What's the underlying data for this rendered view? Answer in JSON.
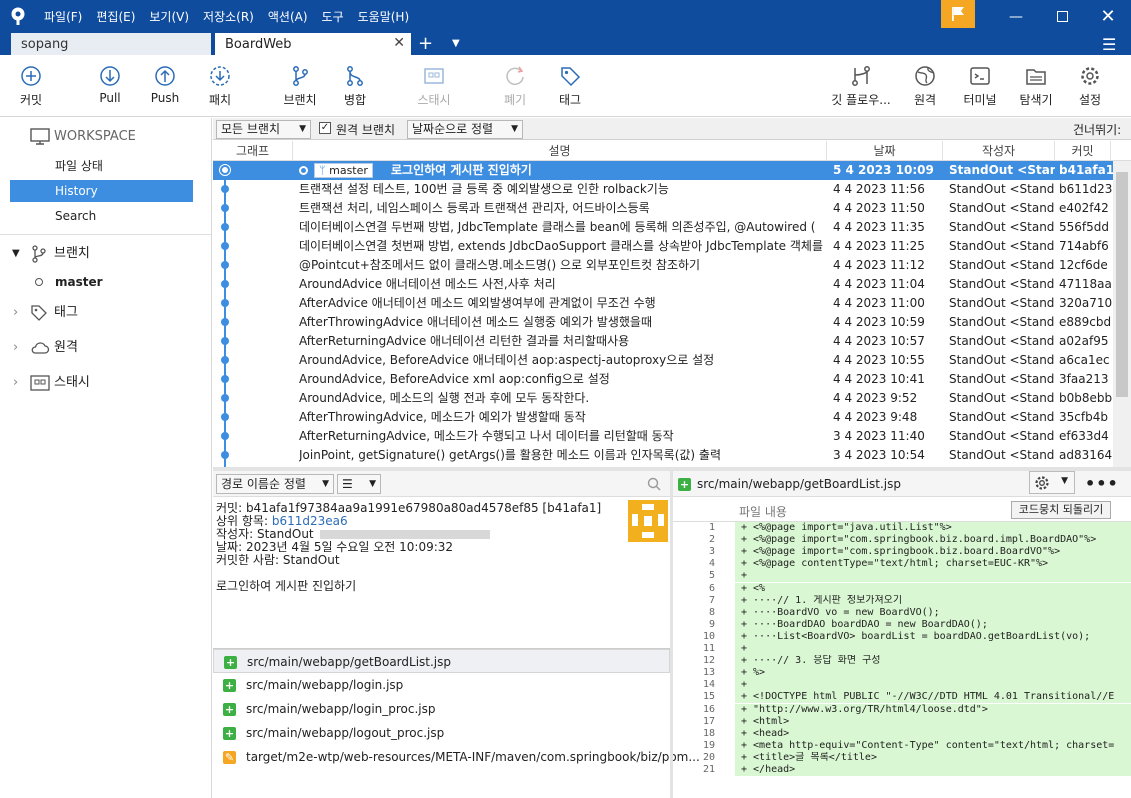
{
  "menu": [
    "파일(F)",
    "편집(E)",
    "보기(V)",
    "저장소(R)",
    "액션(A)",
    "도구",
    "도움말(H)"
  ],
  "tabs": {
    "inactive": "sopang",
    "active": "BoardWeb"
  },
  "toolbar": {
    "commit": "커밋",
    "pull": "Pull",
    "push": "Push",
    "fetch": "패치",
    "branch": "브랜치",
    "merge": "병합",
    "stash": "스태시",
    "discard": "폐기",
    "tag": "태그",
    "gitflow": "깃 플로우...",
    "remote": "원격",
    "terminal": "터미널",
    "explorer": "탐색기",
    "settings": "설정"
  },
  "sidebar": {
    "workspace": "WORKSPACE",
    "file_status": "파일 상태",
    "history": "History",
    "search": "Search",
    "branches": "브랜치",
    "branch_master": "master",
    "tags": "태그",
    "remotes": "원격",
    "stashes": "스태시"
  },
  "filter": {
    "branches": "모든 브랜치",
    "remote_branches": "원격 브랜치",
    "sort": "날짜순으로 정렬",
    "jump": "건너뛰기:"
  },
  "columns": {
    "graph": "그래프",
    "desc": "설명",
    "date": "날짜",
    "author": "작성자",
    "commit": "커밋"
  },
  "commits": [
    {
      "desc": "로그인하여 게시판 진입하기",
      "date": "5 4 2023 10:09",
      "author": "StandOut <Stand",
      "hash": "b41afa1",
      "branch": "master"
    },
    {
      "desc": "트랜잭션 설정 테스트, 100번 글 등록 중 예외발생으로 인한 rolback기능",
      "date": "4 4 2023 11:56",
      "author": "StandOut <Stand(",
      "hash": "b611d23"
    },
    {
      "desc": "트랜잭션 처리, 네임스페이스 등록과 트랜잭션 관리자, 어드바이스등록",
      "date": "4 4 2023 11:50",
      "author": "StandOut <Stand(",
      "hash": "e402f42"
    },
    {
      "desc": "데이터베이스연결 두번째 방법, JdbcTemplate 클래스를 bean에 등록해 의존성주입, @Autowired (",
      "date": "4 4 2023 11:35",
      "author": "StandOut <Stand(",
      "hash": "556f5dd"
    },
    {
      "desc": "데이터베이스연결 첫번째 방법, extends JdbcDaoSupport 클래스를 상속받아 JdbcTemplate 객체를",
      "date": "4 4 2023 11:25",
      "author": "StandOut <Stand(",
      "hash": "714abf6"
    },
    {
      "desc": "@Pointcut+참조메서드 없이 클래스명.메소드명() 으로 외부포인트컷 참조하기",
      "date": "4 4 2023 11:12",
      "author": "StandOut <Stand(",
      "hash": "12cf6de"
    },
    {
      "desc": "AroundAdvice 애너테이션 메소드 사전,사후 처리",
      "date": "4 4 2023 11:04",
      "author": "StandOut <Stand(",
      "hash": "47118aa"
    },
    {
      "desc": "AfterAdvice 애너테이션 메소드 예외발생여부에 관계없이 무조건 수행",
      "date": "4 4 2023 11:00",
      "author": "StandOut <Stand(",
      "hash": "320a710"
    },
    {
      "desc": "AfterThrowingAdvice 애너테이션 메소드 실행중 예외가 발생했을때",
      "date": "4 4 2023 10:59",
      "author": "StandOut <Stand(",
      "hash": "e889cbd"
    },
    {
      "desc": "AfterReturningAdvice 애너테이션 리턴한 결과를 처리할때사용",
      "date": "4 4 2023 10:57",
      "author": "StandOut <Stand(",
      "hash": "a02af95"
    },
    {
      "desc": "AroundAdvice, BeforeAdvice 애너테이션 aop:aspectj-autoproxy으로 설정",
      "date": "4 4 2023 10:55",
      "author": "StandOut <Stand(",
      "hash": "a6ca1ec"
    },
    {
      "desc": "AroundAdvice, BeforeAdvice xml aop:config으로 설정",
      "date": "4 4 2023 10:41",
      "author": "StandOut <Stand(",
      "hash": "3faa213"
    },
    {
      "desc": "AroundAdvice, 메소드의 실행 전과 후에 모두 동작한다.",
      "date": "4 4 2023 9:52",
      "author": "StandOut <Stand(",
      "hash": "b0b8ebb"
    },
    {
      "desc": "AfterThrowingAdvice, 메소드가 예외가 발생할때 동작",
      "date": "4 4 2023 9:48",
      "author": "StandOut <Stand(",
      "hash": "35cfb4b"
    },
    {
      "desc": "AfterReturningAdvice, 메소드가 수행되고 나서 데이터를 리턴할때 동작",
      "date": "3 4 2023 11:40",
      "author": "StandOut <Stand(",
      "hash": "ef633d4"
    },
    {
      "desc": "JoinPoint, getSignature() getArgs()를 활용한 메소드 이름과 인자목록(값) 출력",
      "date": "3 4 2023 10:54",
      "author": "StandOut <Stand(",
      "hash": "ad83164"
    }
  ],
  "lower": {
    "sort": "경로 이름순 정렬",
    "commit_line": "커밋: b41afa1f97384aa9a1991e67980a80ad4578ef85 [b41afa1]",
    "parent_label": "상위 항목:",
    "parent_hash": "b611d23ea6",
    "author_line": "작성자: StandOut",
    "date_line": "날짜: 2023년 4월 5일 수요일 오전 10:09:32",
    "committer_line": "커밋한 사람: StandOut",
    "message": "로그인하여 게시판 진입하기"
  },
  "files": [
    {
      "name": "src/main/webapp/getBoardList.jsp",
      "status": "added"
    },
    {
      "name": "src/main/webapp/login.jsp",
      "status": "added"
    },
    {
      "name": "src/main/webapp/login_proc.jsp",
      "status": "added"
    },
    {
      "name": "src/main/webapp/logout_proc.jsp",
      "status": "added"
    },
    {
      "name": "target/m2e-wtp/web-resources/META-INF/maven/com.springbook/biz/pom...",
      "status": "modified"
    }
  ],
  "diff": {
    "file": "src/main/webapp/getBoardList.jsp",
    "subheader": "파일 내용",
    "revert": "코드뭉치 되돌리기",
    "lines": [
      "+ <%@page import=\"java.util.List\"%>",
      "+ <%@page import=\"com.springbook.biz.board.impl.BoardDAO\"%>",
      "+ <%@page import=\"com.springbook.biz.board.BoardVO\"%>",
      "+ <%@page contentType=\"text/html; charset=EUC-KR\"%>",
      "+",
      "+ <%",
      "+ ····// 1. 게시판 정보가져오기",
      "+ ····BoardVO vo = new BoardVO();",
      "+ ····BoardDAO boardDAO = new BoardDAO();",
      "+ ····List<BoardVO> boardList = boardDAO.getBoardList(vo);",
      "+",
      "+ ····// 3. 응답 화면 구성",
      "+ %>",
      "+",
      "+ <!DOCTYPE html PUBLIC \"-//W3C//DTD HTML 4.01 Transitional//E",
      "+ \"http://www.w3.org/TR/html4/loose.dtd\">",
      "+ <html>",
      "+ <head>",
      "+ <meta http-equiv=\"Content-Type\" content=\"text/html; charset=",
      "+ <title>글 목록</title>",
      "+ </head>"
    ]
  },
  "colors": {
    "titlebar": "#0f4c9e",
    "accent": "#3d8ee0",
    "added": "#3cb043",
    "modified": "#f5a623",
    "diff_bg": "#d9f7d2"
  }
}
